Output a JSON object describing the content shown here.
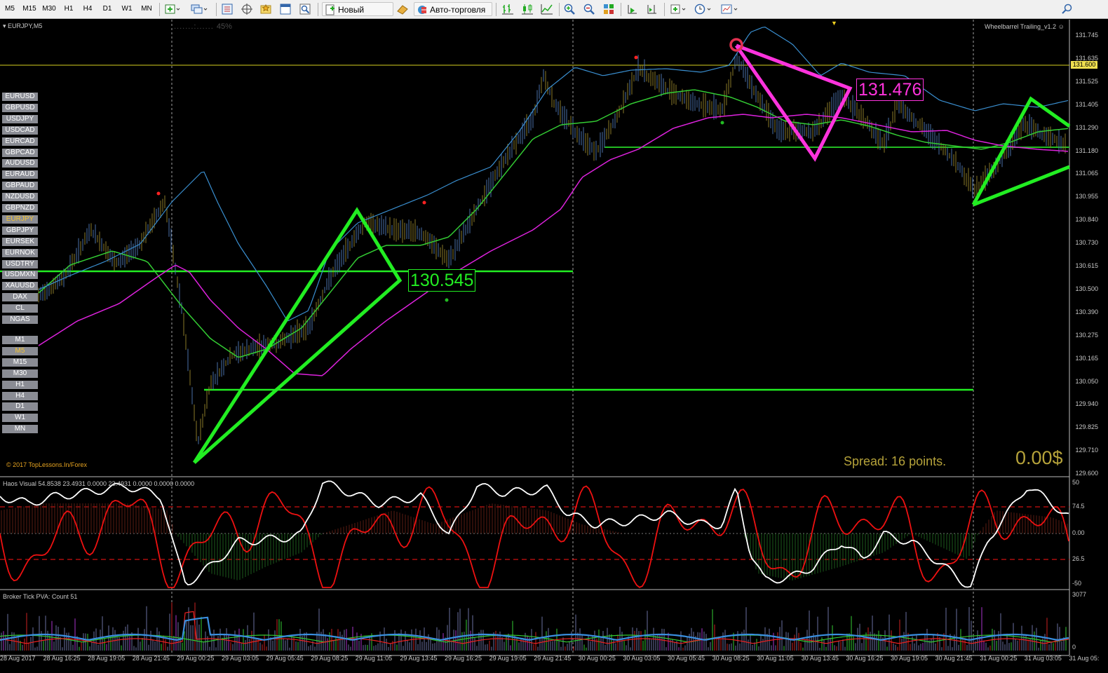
{
  "toolbar": {
    "timeframes": [
      "M5",
      "M15",
      "M30",
      "H1",
      "H4",
      "D1",
      "W1",
      "MN"
    ],
    "new_order_label": "Новый ордер",
    "autotrading_label": "Авто-торговля"
  },
  "chart": {
    "symbol_label": "EURJPY,M5",
    "progress_label": "45%",
    "indicator_label": "Wheelbarrel Trailing_v1.2",
    "copyright": "© 2017 TopLessons.In/Forex",
    "spread_label": "Spread: 16 points.",
    "profit_label": "0.00$",
    "pattern_label_1": "130.545",
    "pattern_label_2": "131.476",
    "current_price": "131.600",
    "price_ticks": [
      "131.745",
      "131.635",
      "131.525",
      "131.405",
      "131.290",
      "131.180",
      "131.065",
      "130.955",
      "130.840",
      "130.730",
      "130.615",
      "130.500",
      "130.390",
      "130.275",
      "130.165",
      "130.050",
      "129.940",
      "129.825",
      "129.710",
      "129.600"
    ],
    "symbols": [
      "EURUSD",
      "GBPUSD",
      "USDJPY",
      "USDCAD",
      "EURCAD",
      "GBPCAD",
      "AUDUSD",
      "EURAUD",
      "GBPAUD",
      "NZDUSD",
      "GBPNZD",
      "EURJPY",
      "GBPJPY",
      "EURSEK",
      "EURNOK",
      "USDTRY",
      "USDMXN",
      "XAUUSD",
      "DAX",
      "CL",
      "NGAS"
    ],
    "active_symbol": "EURJPY",
    "timeframe_buttons": [
      "M1",
      "M5",
      "M15",
      "M30",
      "H1",
      "H4",
      "D1",
      "W1",
      "MN"
    ],
    "active_timeframe": "M5"
  },
  "haos": {
    "label": "Haos Visual 54.8538 23.4931 0.0000 23.4931 0.0000 0.0000 0.0000",
    "ticks": [
      "50",
      "74.5",
      "0.00",
      "26.5",
      "-50"
    ]
  },
  "tick_pva": {
    "label": "Broker Tick PVA:   Count  51",
    "ticks": [
      "3077",
      "0"
    ]
  },
  "time_axis": [
    "28 Aug 2017",
    "28 Aug 16:25",
    "28 Aug 19:05",
    "28 Aug 21:45",
    "29 Aug 00:25",
    "29 Aug 03:05",
    "29 Aug 05:45",
    "29 Aug 08:25",
    "29 Aug 11:05",
    "29 Aug 13:45",
    "29 Aug 16:25",
    "29 Aug 19:05",
    "29 Aug 21:45",
    "30 Aug 00:25",
    "30 Aug 03:05",
    "30 Aug 05:45",
    "30 Aug 08:25",
    "30 Aug 11:05",
    "30 Aug 13:45",
    "30 Aug 16:25",
    "30 Aug 19:05",
    "30 Aug 21:45",
    "31 Aug 00:25",
    "31 Aug 03:05",
    "31 Aug 05:"
  ],
  "colors": {
    "pattern_green": "#22ee22",
    "pattern_magenta": "#ff33dd",
    "ma_green": "#33cc33",
    "ma_magenta": "#dd22dd",
    "ma_blue": "#3a8fd0",
    "osc_red": "#ee1111",
    "osc_white": "#ffffff",
    "spread_text": "#b5a23a"
  }
}
